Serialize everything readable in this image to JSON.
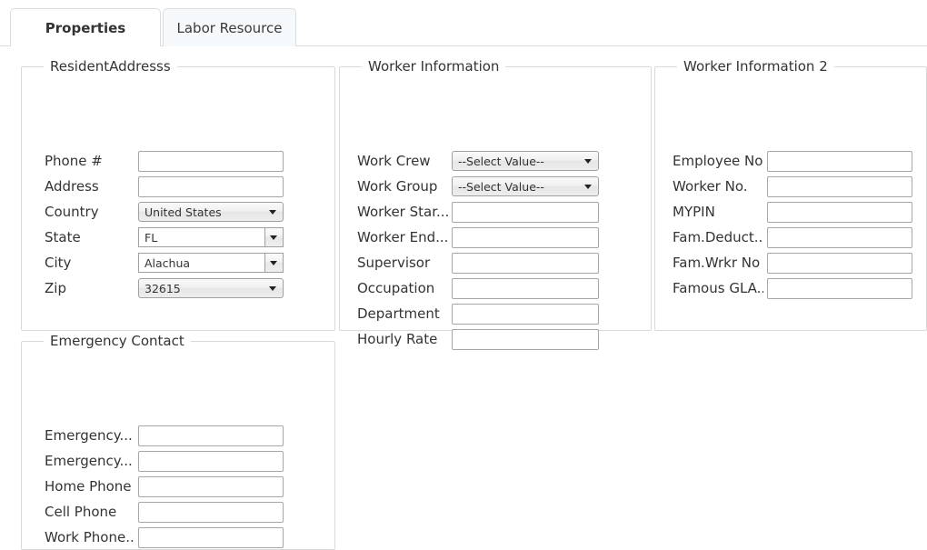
{
  "tabs": [
    {
      "label": "Properties",
      "active": true
    },
    {
      "label": "Labor Resource",
      "active": false
    }
  ],
  "fieldsets": {
    "resident_address": {
      "legend": "ResidentAddresss",
      "rows": [
        {
          "label": "Phone #",
          "control": "text",
          "value": ""
        },
        {
          "label": "Address",
          "control": "text",
          "value": ""
        },
        {
          "label": "Country",
          "control": "select",
          "value": "United States"
        },
        {
          "label": "State",
          "control": "combo",
          "value": "FL"
        },
        {
          "label": "City",
          "control": "combo",
          "value": "Alachua"
        },
        {
          "label": "Zip",
          "control": "select",
          "value": "32615"
        }
      ]
    },
    "worker_information": {
      "legend": "Worker Information",
      "rows": [
        {
          "label": "Work Crew",
          "control": "select",
          "value": "--Select Value--"
        },
        {
          "label": "Work Group",
          "control": "select",
          "value": "--Select Value--"
        },
        {
          "label": "Worker Star...",
          "control": "text",
          "value": ""
        },
        {
          "label": "Worker End...",
          "control": "text",
          "value": ""
        },
        {
          "label": "Supervisor",
          "control": "text",
          "value": ""
        },
        {
          "label": "Occupation",
          "control": "text",
          "value": ""
        },
        {
          "label": "Department",
          "control": "text",
          "value": ""
        },
        {
          "label": "Hourly Rate",
          "control": "text",
          "value": ""
        }
      ]
    },
    "worker_information_2": {
      "legend": "Worker Information 2",
      "rows": [
        {
          "label": "Employee No.",
          "control": "text",
          "value": ""
        },
        {
          "label": "Worker No.",
          "control": "text",
          "value": ""
        },
        {
          "label": "MYPIN",
          "control": "text",
          "value": ""
        },
        {
          "label": "Fam.Deduct...",
          "control": "text",
          "value": ""
        },
        {
          "label": "Fam.Wrkr No",
          "control": "text",
          "value": ""
        },
        {
          "label": "Famous GLA...",
          "control": "text",
          "value": ""
        }
      ]
    },
    "emergency_contact": {
      "legend": "Emergency Contact",
      "rows": [
        {
          "label": "Emergency...",
          "control": "text",
          "value": ""
        },
        {
          "label": "Emergency...",
          "control": "text",
          "value": ""
        },
        {
          "label": "Home Phone",
          "control": "text",
          "value": ""
        },
        {
          "label": "Cell Phone",
          "control": "text",
          "value": ""
        },
        {
          "label": "Work Phone...",
          "control": "text",
          "value": ""
        }
      ]
    }
  },
  "colors": {
    "text": "#333333",
    "fieldset_border": "#d9d9d9",
    "input_border": "#a6a6a6",
    "tab_border": "#dcdcdc",
    "tab_inactive_bg": "#f6f9fc",
    "page_bg": "#ffffff"
  }
}
